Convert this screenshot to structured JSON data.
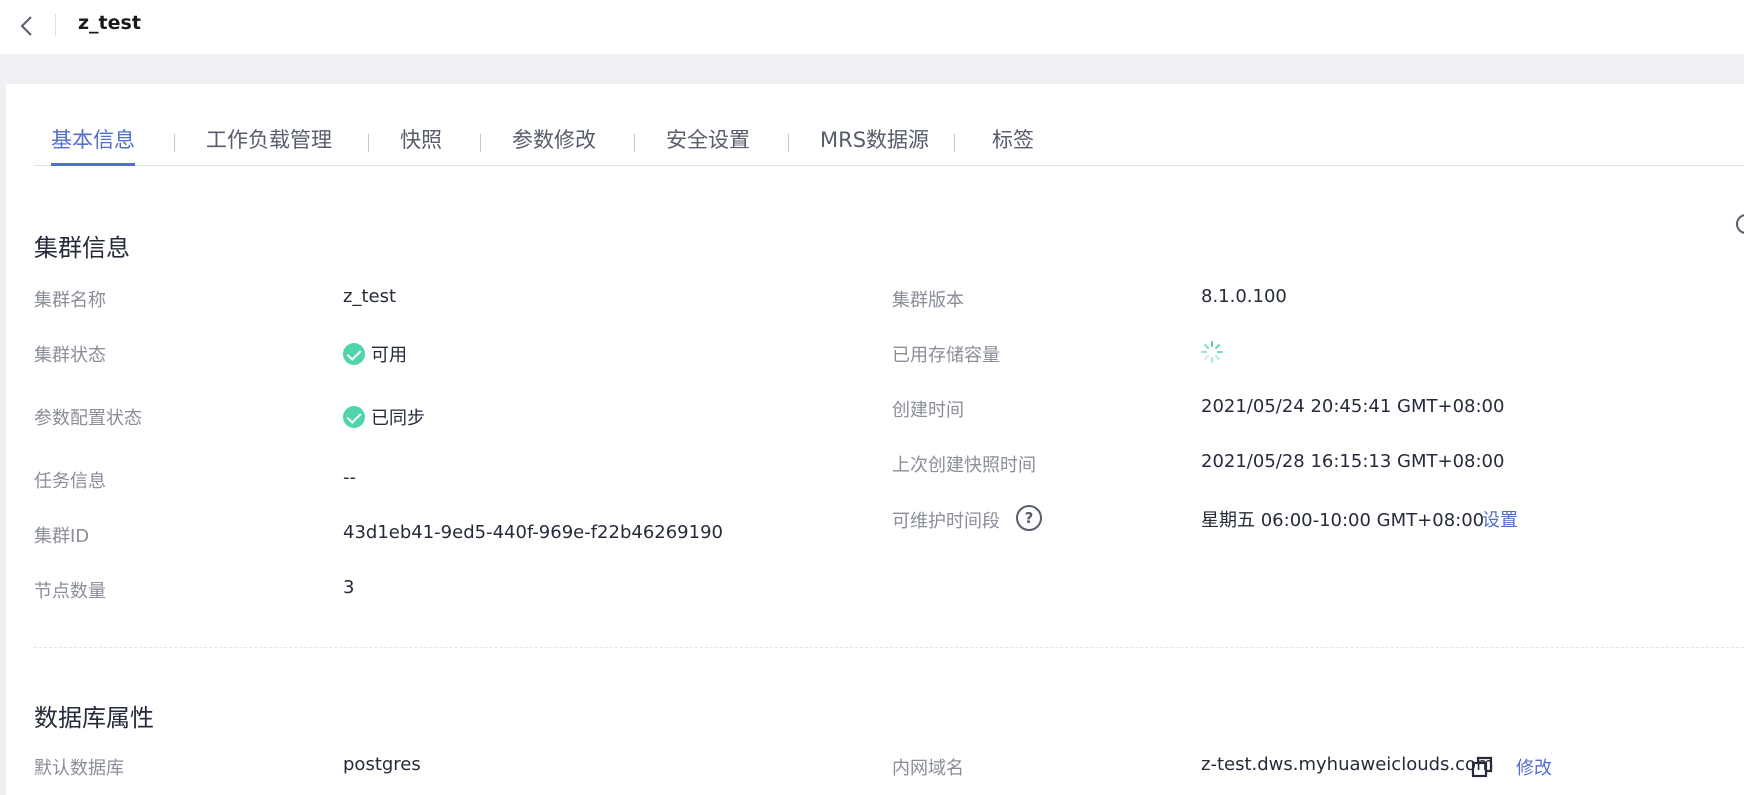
{
  "header": {
    "title": "z_test"
  },
  "tabs": [
    {
      "label": "基本信息"
    },
    {
      "label": "工作负载管理"
    },
    {
      "label": "快照"
    },
    {
      "label": "参数修改"
    },
    {
      "label": "安全设置"
    },
    {
      "label": "MRS数据源"
    },
    {
      "label": "标签"
    }
  ],
  "cluster_info": {
    "title": "集群信息",
    "left": [
      {
        "label": "集群名称",
        "value": "z_test"
      },
      {
        "label": "集群状态",
        "value": "可用"
      },
      {
        "label": "参数配置状态",
        "value": "已同步"
      },
      {
        "label": "任务信息",
        "value": "--"
      },
      {
        "label": "集群ID",
        "value": "43d1eb41-9ed5-440f-969e-f22b46269190"
      },
      {
        "label": "节点数量",
        "value": "3"
      }
    ],
    "right": [
      {
        "label": "集群版本",
        "value": "8.1.0.100"
      },
      {
        "label": "已用存储容量"
      },
      {
        "label": "创建时间",
        "value": "2021/05/24 20:45:41 GMT+08:00"
      },
      {
        "label": "上次创建快照时间",
        "value": "2021/05/28 16:15:13 GMT+08:00"
      },
      {
        "label": "可维护时间段",
        "value": "星期五 06:00-10:00 GMT+08:00",
        "help": "?",
        "action": "设置"
      }
    ]
  },
  "db_props": {
    "title": "数据库属性",
    "left": [
      {
        "label": "默认数据库",
        "value": "postgres"
      }
    ],
    "right": [
      {
        "label": "内网域名",
        "value": "z-test.dws.myhuaweiclouds.com",
        "action": "修改"
      }
    ]
  },
  "colors": {
    "accent": "#526ecc",
    "success": "#50d4ab",
    "label": "#8a8e99",
    "text": "#252b3a"
  }
}
